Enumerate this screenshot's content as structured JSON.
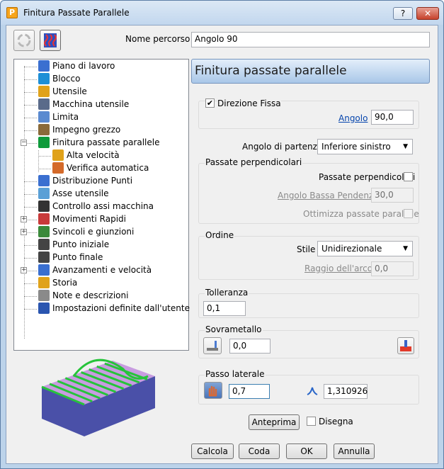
{
  "window": {
    "title": "Finitura Passate Parallele",
    "app_icon_letter": "P",
    "help_label": "?",
    "close_label": "✕"
  },
  "toolbar": {
    "left_icon": "recycle-icon",
    "right_icon": "strategy-icon"
  },
  "path_name": {
    "label": "Nome percorso",
    "value": "Angolo 90"
  },
  "tree": {
    "items": [
      {
        "label": "Piano di lavoro",
        "icon": "workplane-icon",
        "expandable": false,
        "level": 0
      },
      {
        "label": "Blocco",
        "icon": "block-icon",
        "expandable": false,
        "level": 0
      },
      {
        "label": "Utensile",
        "icon": "tool-icon",
        "expandable": false,
        "level": 0
      },
      {
        "label": "Macchina utensile",
        "icon": "machine-tool-icon",
        "expandable": false,
        "level": 0
      },
      {
        "label": "Limita",
        "icon": "limit-icon",
        "expandable": false,
        "level": 0
      },
      {
        "label": "Impegno grezzo",
        "icon": "stock-engagement-icon",
        "expandable": false,
        "level": 0
      },
      {
        "label": "Finitura passate parallele",
        "icon": "parallel-finishing-icon",
        "expandable": true,
        "expanded": true,
        "level": 0
      },
      {
        "label": "Alta velocità",
        "icon": "high-speed-icon",
        "expandable": false,
        "level": 1
      },
      {
        "label": "Verifica automatica",
        "icon": "auto-verify-icon",
        "expandable": false,
        "level": 1
      },
      {
        "label": "Distribuzione Punti",
        "icon": "point-distribution-icon",
        "expandable": false,
        "level": 0
      },
      {
        "label": "Asse utensile",
        "icon": "tool-axis-icon",
        "expandable": false,
        "level": 0
      },
      {
        "label": "Controllo assi macchina",
        "icon": "axis-control-icon",
        "expandable": false,
        "level": 0
      },
      {
        "label": "Movimenti Rapidi",
        "icon": "rapid-moves-icon",
        "expandable": true,
        "expanded": false,
        "level": 0
      },
      {
        "label": "Svincoli e giunzioni",
        "icon": "leads-links-icon",
        "expandable": true,
        "expanded": false,
        "level": 0
      },
      {
        "label": "Punto iniziale",
        "icon": "start-point-icon",
        "expandable": false,
        "level": 0
      },
      {
        "label": "Punto finale",
        "icon": "end-point-icon",
        "expandable": false,
        "level": 0
      },
      {
        "label": "Avanzamenti e velocità",
        "icon": "feeds-speeds-icon",
        "expandable": true,
        "expanded": false,
        "level": 0
      },
      {
        "label": "Storia",
        "icon": "history-icon",
        "expandable": false,
        "level": 0
      },
      {
        "label": "Note e descrizioni",
        "icon": "notes-icon",
        "expandable": false,
        "level": 0
      },
      {
        "label": "Impostazioni definite dall'utente",
        "icon": "user-settings-icon",
        "expandable": false,
        "level": 0
      }
    ]
  },
  "panel": {
    "heading": "Finitura passate parallele",
    "fixed_direction": {
      "label": "Direzione Fissa",
      "checked": true
    },
    "angle": {
      "label": "Angolo",
      "value": "90,0"
    },
    "start_corner": {
      "label": "Angolo di partenza",
      "value": "Inferiore sinistro"
    },
    "perpendicular": {
      "title": "Passate perpendicolari",
      "perp_passes": {
        "label": "Passate perpendicolari",
        "checked": false
      },
      "shallow_angle": {
        "label": "Angolo Bassa Pendenza",
        "value": "30,0"
      },
      "optimize": {
        "label": "Ottimizza passate parallele",
        "checked": false
      }
    },
    "order": {
      "title": "Ordine",
      "style": {
        "label": "Stile",
        "value": "Unidirezionale"
      },
      "arc_radius": {
        "label": "Raggio dell'arco",
        "value": "0,0"
      }
    },
    "tolerance": {
      "title": "Tolleranza",
      "value": "0,1"
    },
    "thickness": {
      "title": "Sovrametallo",
      "value": "0,0",
      "left_icon": "thickness-icon",
      "right_icon": "component-thickness-icon"
    },
    "stepover": {
      "title": "Passo laterale",
      "value": "0,7",
      "cusp_value": "1,310926",
      "left_icon": "hand-icon",
      "cusp_icon": "cusp-icon"
    },
    "preview_button": "Anteprima",
    "draw": {
      "label": "Disegna",
      "checked": false
    }
  },
  "footer": {
    "calculate": "Calcola",
    "queue": "Coda",
    "ok": "OK",
    "cancel": "Annulla"
  },
  "colors": {
    "part_top": "#c89ce0",
    "part_side": "#4a50a8",
    "stripe": "#26c43a"
  }
}
